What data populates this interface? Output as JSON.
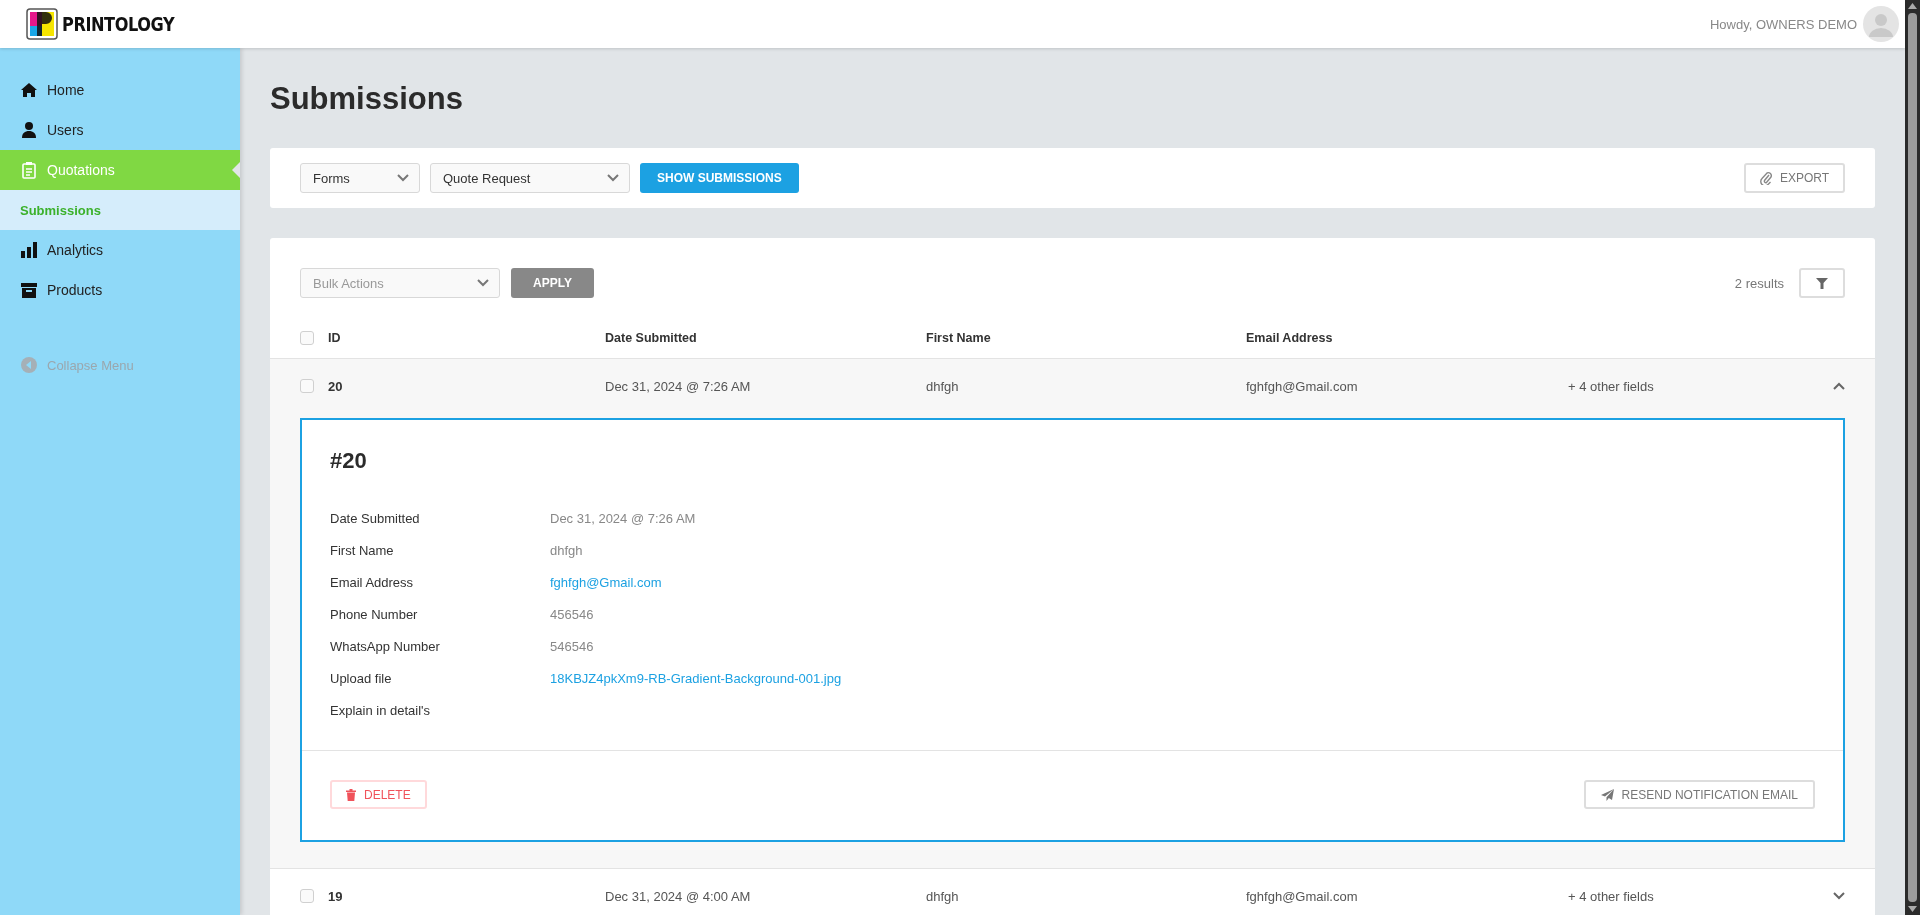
{
  "header": {
    "brand": "PRINTOLOGY",
    "greeting": "Howdy, OWNERS DEMO"
  },
  "sidebar": {
    "items": [
      {
        "label": "Home",
        "kind": "home",
        "selected": false
      },
      {
        "label": "Users",
        "kind": "user",
        "selected": false
      },
      {
        "label": "Quotations",
        "kind": "clipboard",
        "selected": true,
        "children": [
          {
            "label": "Submissions",
            "selected": true
          }
        ]
      },
      {
        "label": "Analytics",
        "kind": "chart",
        "selected": false
      },
      {
        "label": "Products",
        "kind": "archive",
        "selected": false
      }
    ],
    "collapse": "Collapse Menu"
  },
  "page_title": "Submissions",
  "toolbar": {
    "form_type": "Forms",
    "form": "Quote Request",
    "show_button": "SHOW SUBMISSIONS",
    "export_button": "EXPORT"
  },
  "list": {
    "bulk_actions": {
      "placeholder": "Bulk Actions"
    },
    "apply_button": "APPLY",
    "results": "2 results",
    "select_all": {
      "checked": false
    },
    "columns": [
      "ID",
      "Date Submitted",
      "First Name",
      "Email Address"
    ],
    "rows": [
      {
        "id": "20",
        "date": "Dec 31, 2024 @ 7:26 AM",
        "first_name": "dhfgh",
        "email": "fghfgh@Gmail.com",
        "more": "+ 4 other fields",
        "checked": false,
        "expanded": true,
        "detail": {
          "title": "#20",
          "fields": [
            {
              "label": "Date Submitted",
              "value": "Dec 31, 2024 @ 7:26 AM",
              "kind": "text"
            },
            {
              "label": "First Name",
              "value": "dhfgh",
              "kind": "text"
            },
            {
              "label": "Email Address",
              "value": "fghfgh@Gmail.com",
              "kind": "link"
            },
            {
              "label": "Phone Number",
              "value": "456546",
              "kind": "text"
            },
            {
              "label": "WhatsApp Number",
              "value": "546546",
              "kind": "text"
            },
            {
              "label": "Upload file",
              "value": "18KBJZ4pkXm9-RB-Gradient-Background-001.jpg",
              "kind": "link"
            },
            {
              "label": "Explain in detail's",
              "kind": "empty"
            }
          ],
          "delete_button": "DELETE",
          "resend_button": "RESEND NOTIFICATION EMAIL"
        }
      },
      {
        "id": "19",
        "date": "Dec 31, 2024 @ 4:00 AM",
        "first_name": "dhfgh",
        "email": "fghfgh@Gmail.com",
        "more": "+ 4 other fields",
        "checked": false,
        "expanded": false
      }
    ]
  }
}
